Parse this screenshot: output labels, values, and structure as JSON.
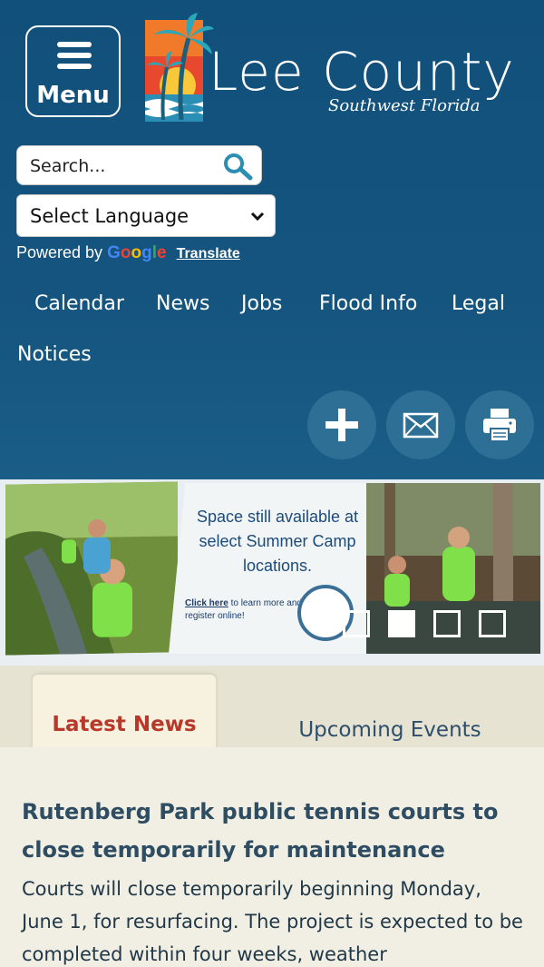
{
  "header": {
    "menu_label": "Menu",
    "logo_title": "Lee County",
    "logo_subtitle": "Southwest Florida"
  },
  "search": {
    "placeholder": "Search..."
  },
  "language": {
    "selected": "Select Language",
    "powered_by": "Powered by",
    "google": [
      "G",
      "o",
      "o",
      "g",
      "l",
      "e"
    ],
    "google_colors": [
      "#4285F4",
      "#EA4335",
      "#FBBC05",
      "#4285F4",
      "#34A853",
      "#EA4335"
    ],
    "translate": "Translate"
  },
  "nav": {
    "items": [
      "Calendar",
      "News",
      "Jobs",
      "Flood Info",
      "Legal",
      "Notices"
    ]
  },
  "actions": {
    "icons": [
      "plus-icon",
      "mail-icon",
      "print-icon"
    ]
  },
  "banner": {
    "caption": "Space still available at select Summer Camp locations.",
    "cta_link": "Click here",
    "cta_rest": "to learn more and register online!",
    "slides": 4,
    "active_slide": 2
  },
  "tabs": {
    "active": "Latest News",
    "inactive": "Upcoming Events"
  },
  "news": {
    "title": "Rutenberg Park public tennis courts to close temporarily for maintenance",
    "body": "Courts will close temporarily beginning Monday, June 1, for resurfacing. The project is expected to be completed within four weeks, weather"
  },
  "colors": {
    "header_bg": "#14537a",
    "accent_red": "#b8392b",
    "tab_bg": "#f7f2df"
  }
}
